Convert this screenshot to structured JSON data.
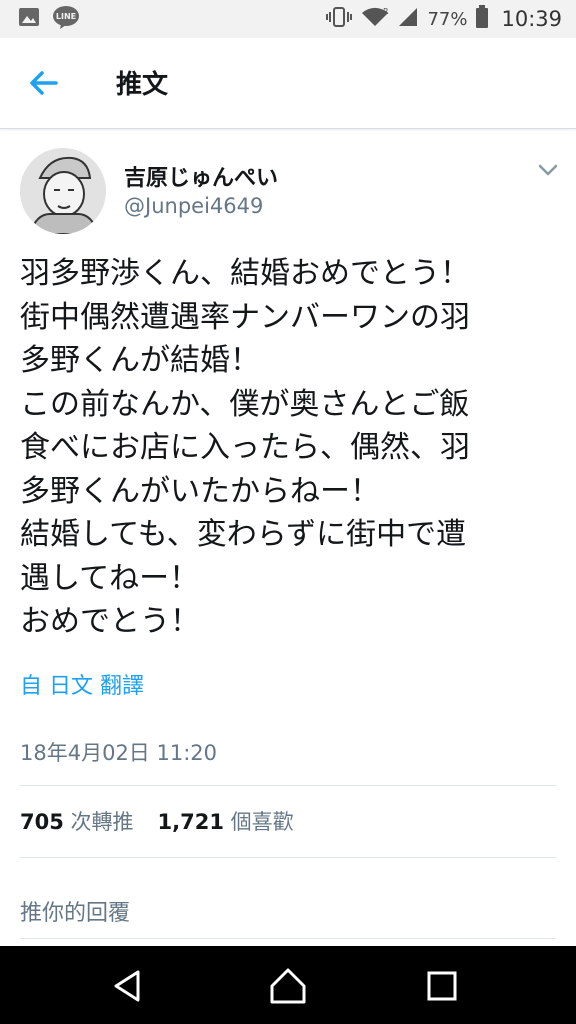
{
  "status_bar": {
    "battery_percent": "77%",
    "time": "10:39",
    "icons": [
      "gallery-icon",
      "line-app-icon",
      "vibrate-icon",
      "wifi-icon",
      "signal-icon",
      "battery-icon"
    ]
  },
  "header": {
    "title": "推文"
  },
  "author": {
    "name": "吉原じゅんぺい",
    "handle": "@Junpei4649"
  },
  "tweet": {
    "lines": [
      "羽多野渉くん、結婚おめでとう！",
      "街中偶然遭遇率ナンバーワンの羽",
      "多野くんが結婚！",
      "この前なんか、僕が奥さんとご飯",
      "食べにお店に入ったら、偶然、羽",
      "多野くんがいたからねー！",
      "結婚しても、変わらずに街中で遭",
      "遇してねー！",
      "おめでとう！"
    ],
    "translate_label": "自 日文 翻譯",
    "timestamp": "18年4月02日 11:20"
  },
  "stats": {
    "retweets_count": "705",
    "retweets_label": "次轉推",
    "likes_count": "1,721",
    "likes_label": "個喜歡"
  },
  "reply": {
    "placeholder": "推你的回覆"
  },
  "colors": {
    "accent": "#1da1f2",
    "secondary_text": "#657786",
    "primary_text": "#14171a",
    "status_bar_bg": "#f2f2f2",
    "nav_bar_bg": "#000000"
  }
}
